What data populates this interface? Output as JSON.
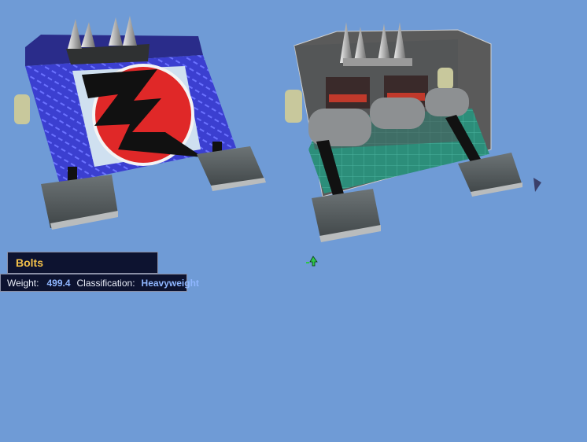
{
  "robot": {
    "name": "Bolts",
    "weight_label": "Weight:",
    "weight_value": "499.4",
    "classification_label": "Classification:",
    "classification_value": "Heavyweight"
  },
  "icons": {
    "move_cursor": "move-arrow-icon",
    "rotate_handle": "triangle-handle-icon"
  },
  "colors": {
    "background": "#6f9bd6",
    "panel": "#0d1330",
    "name_text": "#f3c14a",
    "value_text": "#8fb6ff"
  }
}
